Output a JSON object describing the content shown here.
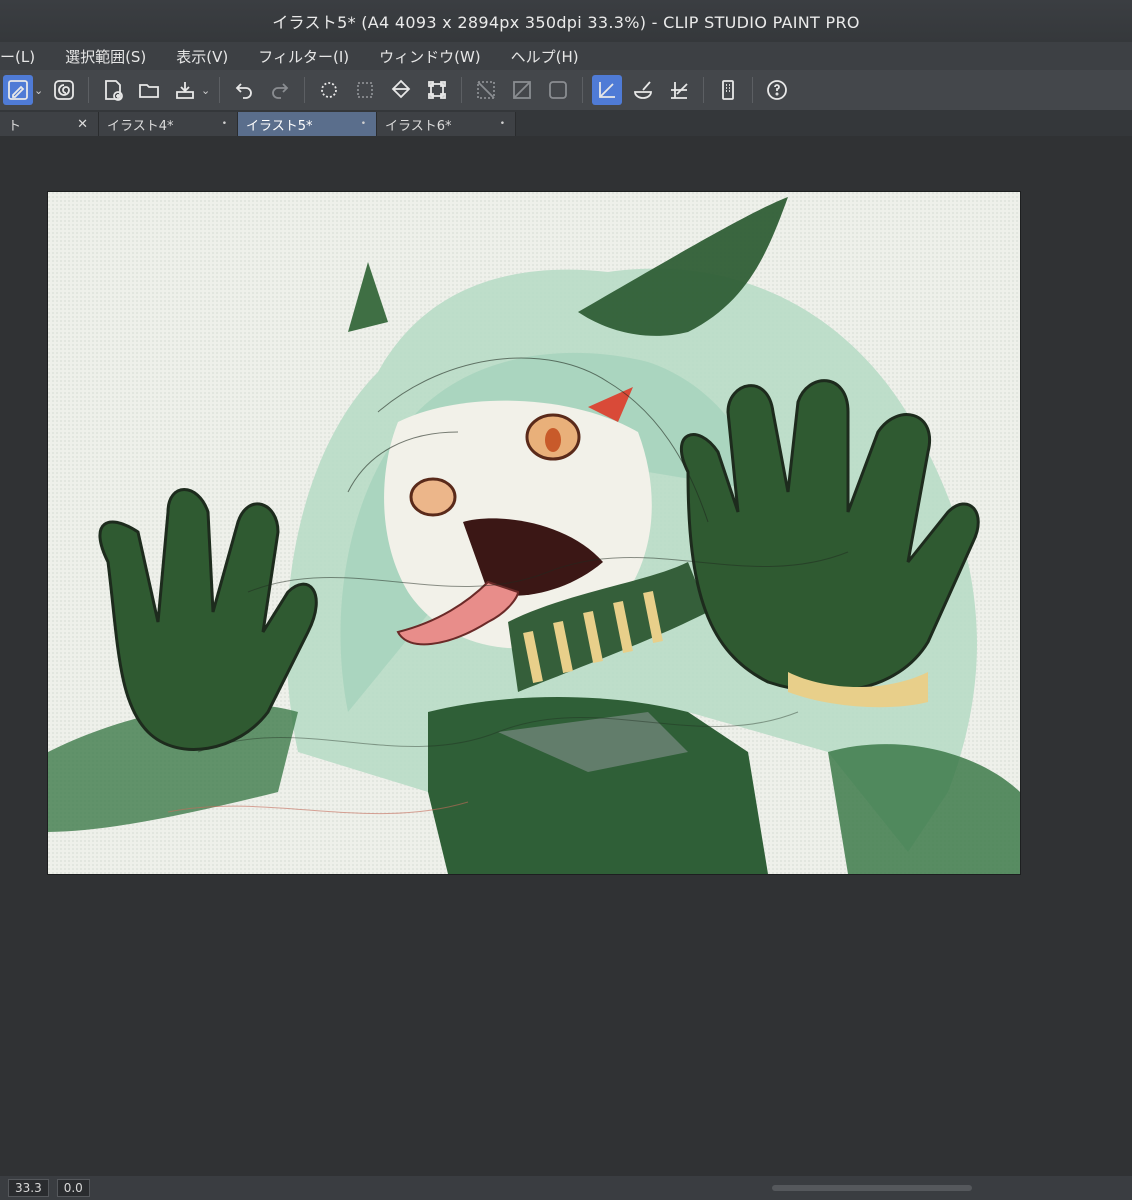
{
  "window": {
    "title": "イラスト5* (A4 4093 x 2894px 350dpi 33.3%)  - CLIP STUDIO PAINT PRO"
  },
  "menu": {
    "items": [
      "ー(L)",
      "選択範囲(S)",
      "表示(V)",
      "フィルター(I)",
      "ウィンドウ(W)",
      "ヘルプ(H)"
    ]
  },
  "toolbar": {
    "icons": [
      "pen-icon",
      "swirl-icon",
      "new-canvas-icon",
      "open-folder-icon",
      "export-icon",
      "undo-icon",
      "redo-icon",
      "loading-spin-icon",
      "select-all-icon",
      "fill-icon",
      "transform-icon",
      "clear-selection-icon",
      "invert-selection-icon",
      "border-icon",
      "snap-ruler-icon",
      "snap-special-icon",
      "snap-grid-icon",
      "device-icon",
      "help-icon"
    ]
  },
  "tabs": [
    {
      "label": "ト",
      "close": "✕"
    },
    {
      "label": "イラスト4*",
      "close": "•"
    },
    {
      "label": "イラスト5*",
      "close": "•"
    },
    {
      "label": "イラスト6*",
      "close": "•"
    }
  ],
  "status": {
    "zoom": "33.3",
    "angle": "0.0"
  },
  "colors": {
    "accent": "#4f7bd6",
    "active_tab": "#5a6e8c",
    "canvas_bg": "#eef0ea"
  }
}
